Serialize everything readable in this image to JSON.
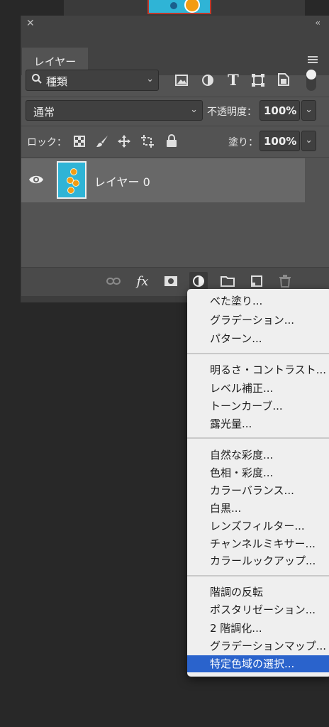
{
  "panel": {
    "tab_label": "レイヤー",
    "filter": {
      "label": "種類",
      "icon": "search-icon"
    },
    "blend_mode": "通常",
    "opacity_label": "不透明度：",
    "opacity_value": "100%",
    "lock_label": "ロック：",
    "fill_label": "塗り：",
    "fill_value": "100%",
    "layers": [
      {
        "name": "レイヤー 0",
        "visible": true
      }
    ]
  },
  "adjustment_menu": {
    "groups": [
      [
        "べた塗り...",
        "グラデーション...",
        "パターン..."
      ],
      [
        "明るさ・コントラスト...",
        "レベル補正...",
        "トーンカーブ...",
        "露光量..."
      ],
      [
        "自然な彩度...",
        "色相・彩度...",
        "カラーバランス...",
        "白黒...",
        "レンズフィルター...",
        "チャンネルミキサー...",
        "カラールックアップ..."
      ],
      [
        "階調の反転",
        "ポスタリゼーション...",
        "2 階調化...",
        "グラデーションマップ...",
        "特定色域の選択..."
      ]
    ],
    "selected": "特定色域の選択...",
    "highlight_color": "#2a63cc"
  }
}
